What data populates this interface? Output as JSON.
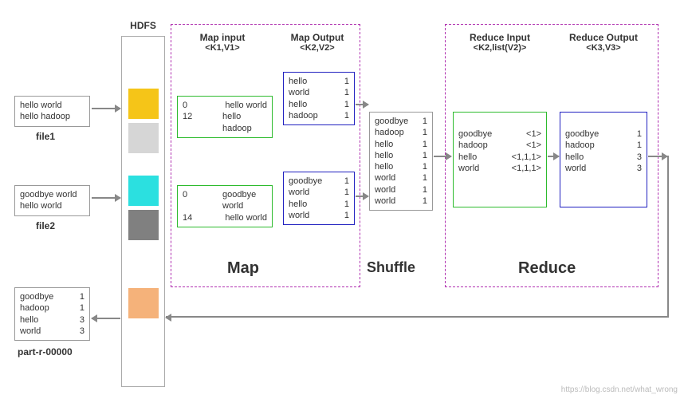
{
  "hdfs_title": "HDFS",
  "file1": {
    "lines": [
      "hello world",
      "hello hadoop"
    ],
    "label": "file1"
  },
  "file2": {
    "lines": [
      "goodbye world",
      "hello world"
    ],
    "label": "file2"
  },
  "output": {
    "rows": [
      [
        "goodbye",
        "1"
      ],
      [
        "hadoop",
        "1"
      ],
      [
        "hello",
        "3"
      ],
      [
        "world",
        "3"
      ]
    ],
    "label": "part-r-00000"
  },
  "blocks": {
    "b1": "#f5c518",
    "b2": "#d6d6d6",
    "b3": "#2be0e0",
    "b4": "#808080",
    "b5": "#f5b27a"
  },
  "map": {
    "title": "Map",
    "input_title": "Map input",
    "input_sub": "<K1,V1>",
    "output_title": "Map Output",
    "output_sub": "<K2,V2>",
    "in1": [
      [
        "0",
        "hello world"
      ],
      [
        "12",
        "hello hadoop"
      ]
    ],
    "in2": [
      [
        "0",
        "goodbye world"
      ],
      [
        "14",
        "hello world"
      ]
    ],
    "out1": [
      [
        "hello",
        "1"
      ],
      [
        "world",
        "1"
      ],
      [
        "hello",
        "1"
      ],
      [
        "hadoop",
        "1"
      ]
    ],
    "out2": [
      [
        "goodbye",
        "1"
      ],
      [
        "world",
        "1"
      ],
      [
        "hello",
        "1"
      ],
      [
        "world",
        "1"
      ]
    ]
  },
  "shuffle": {
    "title": "Shuffle",
    "rows": [
      [
        "goodbye",
        "1"
      ],
      [
        "hadoop",
        "1"
      ],
      [
        "hello",
        "1"
      ],
      [
        "hello",
        "1"
      ],
      [
        "hello",
        "1"
      ],
      [
        "world",
        "1"
      ],
      [
        "world",
        "1"
      ],
      [
        "world",
        "1"
      ]
    ]
  },
  "reduce": {
    "title": "Reduce",
    "input_title": "Reduce Input",
    "input_sub": "<K2,list(V2)>",
    "output_title": "Reduce Output",
    "output_sub": "<K3,V3>",
    "in": [
      [
        "goodbye",
        "<1>"
      ],
      [
        "hadoop",
        "<1>"
      ],
      [
        "hello",
        "<1,1,1>"
      ],
      [
        "world",
        "<1,1,1>"
      ]
    ],
    "out": [
      [
        "goodbye",
        "1"
      ],
      [
        "hadoop",
        "1"
      ],
      [
        "hello",
        "3"
      ],
      [
        "world",
        "3"
      ]
    ]
  },
  "watermark": "https://blog.csdn.net/what_wrong"
}
